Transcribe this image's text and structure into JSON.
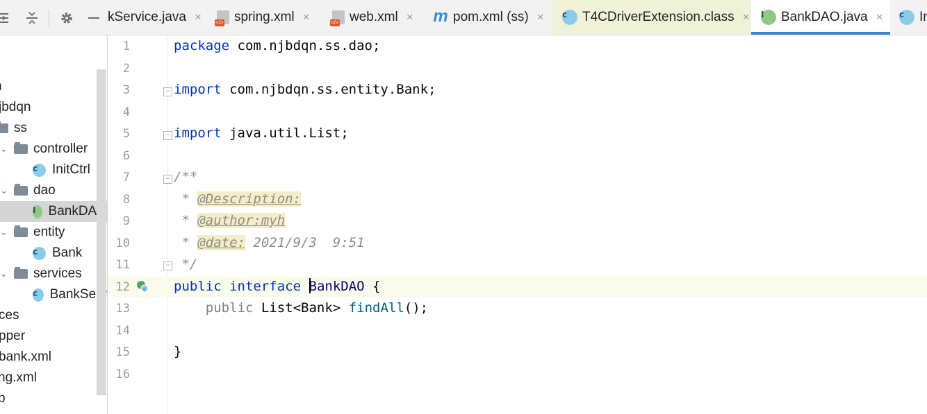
{
  "toolbar": {
    "icons": [
      "collapse-all-icon",
      "expand-all-icon",
      "gear-icon",
      "hide-icon"
    ]
  },
  "tabs": [
    {
      "label": "kService.java",
      "icon": "none",
      "close": "×"
    },
    {
      "label": "spring.xml",
      "icon": "xml-icon",
      "close": "×"
    },
    {
      "label": "web.xml",
      "icon": "xml-icon",
      "close": "×"
    },
    {
      "label": "pom.xml (ss)",
      "icon": "maven-icon",
      "close": "×"
    },
    {
      "label": "T4CDriverExtension.class",
      "icon": "class-icon",
      "close": "×"
    },
    {
      "label": "BankDAO.java",
      "icon": "interface-icon",
      "close": "×"
    },
    {
      "label": "In",
      "icon": "class-icon",
      "close": ""
    }
  ],
  "tree": {
    "rows": [
      {
        "label": "n",
        "type": "text"
      },
      {
        "label": "jbdqn",
        "type": "text"
      },
      {
        "label": "ss",
        "type": "folder"
      },
      {
        "label": "controller",
        "type": "folder"
      },
      {
        "label": "InitCtrl",
        "type": "class"
      },
      {
        "label": "dao",
        "type": "folder"
      },
      {
        "label": "BankDAO",
        "type": "interface",
        "selected": true
      },
      {
        "label": "entity",
        "type": "folder"
      },
      {
        "label": "Bank",
        "type": "class"
      },
      {
        "label": "services",
        "type": "folder"
      },
      {
        "label": "BankServ",
        "type": "class"
      },
      {
        "label": "ces",
        "type": "text"
      },
      {
        "label": "pper",
        "type": "text"
      },
      {
        "label": "bank.xml",
        "type": "text"
      },
      {
        "label": "ng.xml",
        "type": "text"
      },
      {
        "label": "p",
        "type": "text"
      }
    ]
  },
  "editor": {
    "line_numbers": [
      "1",
      "2",
      "3",
      "4",
      "5",
      "6",
      "7",
      "8",
      "9",
      "10",
      "11",
      "12",
      "13",
      "14",
      "15",
      "16"
    ],
    "current_line": "12",
    "line1": {
      "kw": "package",
      "rest": " com.njbdqn.ss.dao;"
    },
    "line3": {
      "kw": "import",
      "rest": " com.njbdqn.ss.entity.Bank;"
    },
    "line5": {
      "kw": "import",
      "rest": " java.util.List;"
    },
    "line7": {
      "text": "/**"
    },
    "line8": {
      "prefix": " * ",
      "tag": "@Description:"
    },
    "line9": {
      "prefix": " * ",
      "tag": "@author:myh"
    },
    "line10": {
      "prefix": " * ",
      "tag": "@date:",
      "rest": " 2021/9/3  9:51"
    },
    "line11": {
      "text": " */"
    },
    "line12": {
      "kw1": "public",
      "kw2": "interface",
      "name": "BankDAO",
      "rest": " {"
    },
    "line13": {
      "kw": "public",
      "mid": " List<Bank> ",
      "meth": "findAll",
      "rest": "();"
    },
    "line15": {
      "text": "}"
    }
  }
}
